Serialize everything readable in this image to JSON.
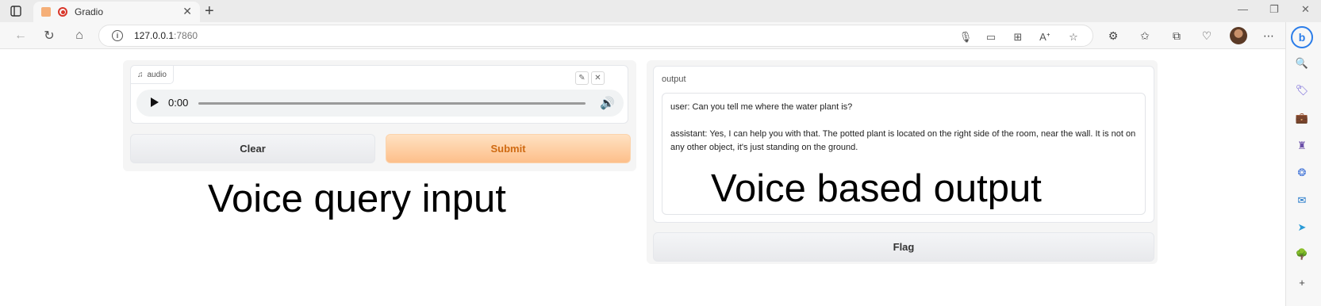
{
  "browser": {
    "tab_title": "Gradio",
    "new_tab_symbol": "+",
    "url_host": "127.0.0.1",
    "url_port": ":7860",
    "bing_label": "b"
  },
  "app": {
    "audio_label": "audio",
    "audio_time": "0:00",
    "clear_label": "Clear",
    "submit_label": "Submit",
    "output_label": "output",
    "output_lines": [
      "user: Can you tell me where the water plant is?",
      "assistant: Yes, I can help you with that. The potted plant is located on the right side of the room, near the wall. It is not on any other object, it's just standing on the ground."
    ],
    "flag_label": "Flag",
    "accent_color": "#fdbf8a"
  },
  "annotations": {
    "left": "Voice query input",
    "right": "Voice based output"
  },
  "icons": [
    "sidebar-toggle-icon",
    "close-icon",
    "back-icon",
    "refresh-icon",
    "home-icon",
    "info-icon",
    "mic-icon",
    "cast-icon",
    "apps-icon",
    "read-aloud-icon",
    "star-icon",
    "extensions-icon",
    "favorites-icon",
    "collections-icon",
    "health-icon",
    "more-icon",
    "search-icon",
    "tag-icon",
    "briefcase-icon",
    "chess-icon",
    "copilot-icon",
    "outlook-icon",
    "send-icon",
    "tree-icon",
    "add-icon",
    "music-icon",
    "edit-icon",
    "play-icon",
    "volume-icon"
  ]
}
